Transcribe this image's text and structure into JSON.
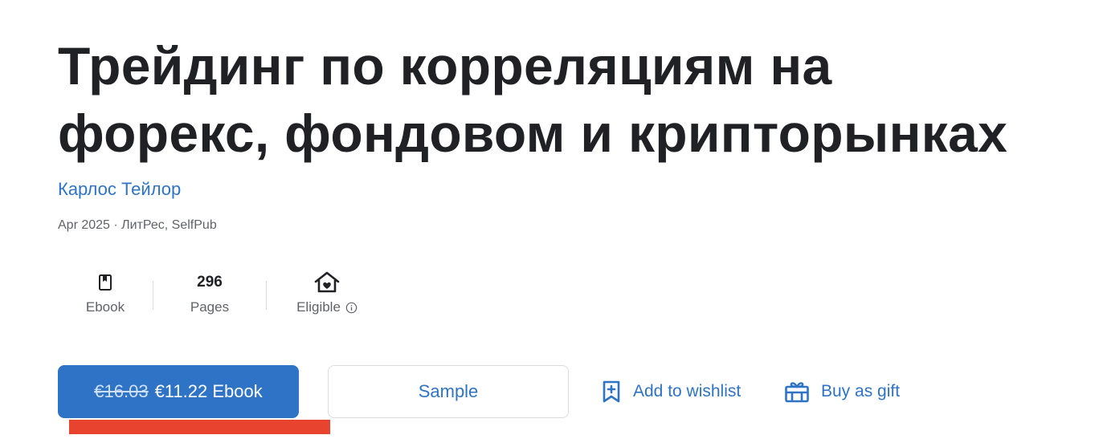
{
  "book": {
    "title": "Трейдинг по корреляциям на форекс, фондовом и крипторынках",
    "author": "Карлос Тейлор",
    "meta": "Apr 2025 · ЛитРес, SelfPub"
  },
  "stats": {
    "format_icon": "bookmark-book-icon",
    "format_label": "Ebook",
    "pages_value": "296",
    "pages_label": "Pages",
    "eligible_icon": "family-home-heart-icon",
    "eligible_label": "Eligible",
    "info_icon": "info-icon"
  },
  "actions": {
    "old_price": "€16.03",
    "buy_label": "€11.22 Ebook",
    "sample_label": "Sample",
    "wishlist_icon": "bookmark-add-icon",
    "wishlist_label": "Add to wishlist",
    "gift_icon": "gift-icon",
    "gift_label": "Buy as gift"
  },
  "colors": {
    "accent": "#2f73c6",
    "annotation": "#e8432f",
    "text": "#202124",
    "muted": "#5f6368"
  }
}
